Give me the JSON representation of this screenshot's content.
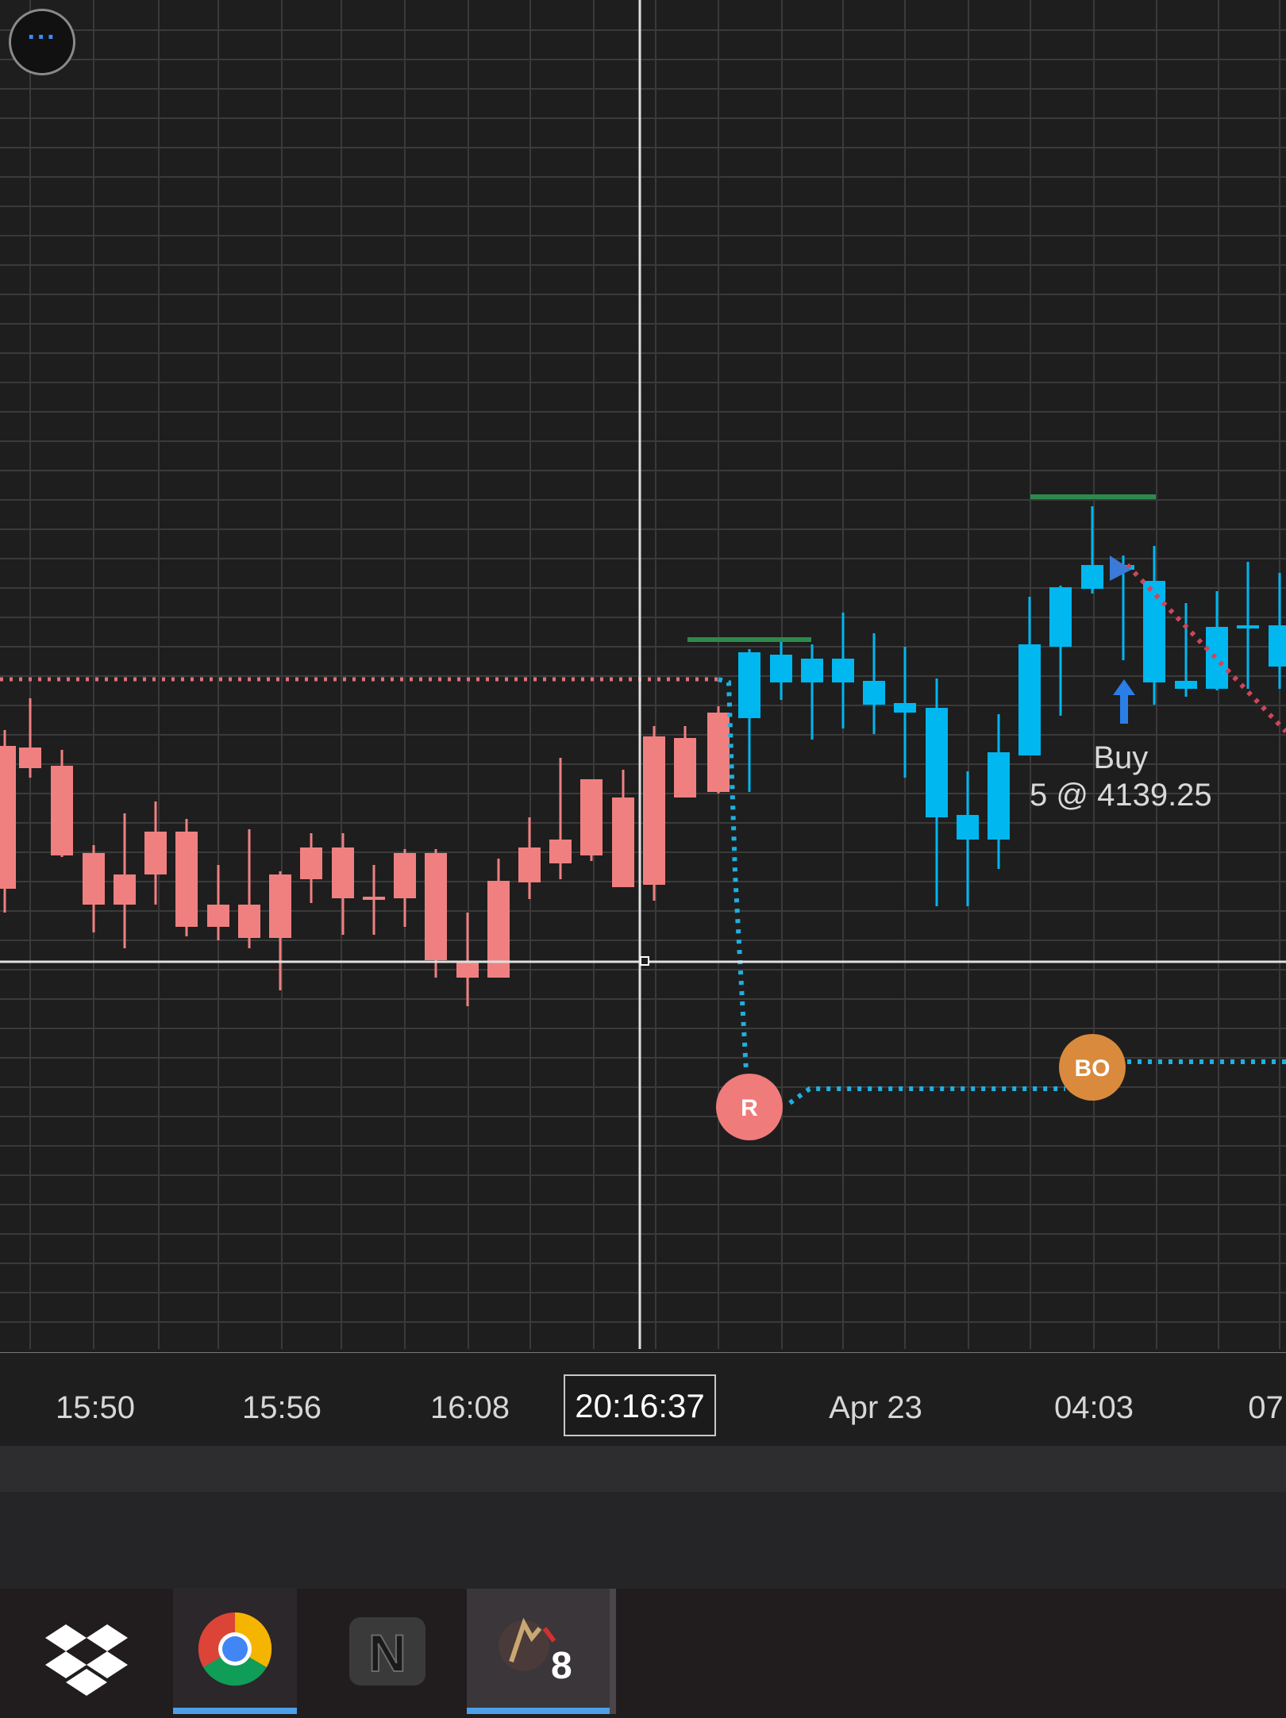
{
  "chart": {
    "x_axis_labels": [
      "15:50",
      "15:56",
      "16:08",
      "Apr 23",
      "04:03",
      "07:"
    ],
    "crosshair_time": "20:16:37",
    "menu_label": "···",
    "order_markers": [
      {
        "id": "R",
        "label": "R",
        "color": "#f07b7b"
      },
      {
        "id": "BO",
        "label": "BO",
        "color": "#d98a3c"
      }
    ],
    "buy_annotation": {
      "title": "Buy",
      "detail": "5 @ 4139.25"
    },
    "colors": {
      "up_candle": "#00b7f0",
      "down_candle": "#f08080",
      "background": "#1e1e1e",
      "grid": "#3a3a3a",
      "high_marker": "#2d8a4e",
      "order_line": "#1eb0e0",
      "stop_line": "#e0707a",
      "buy_arrow": "#2a7ee8",
      "crosshair": "#e0e0e0"
    }
  },
  "taskbar": {
    "icons": [
      {
        "name": "dropbox-icon",
        "active": false
      },
      {
        "name": "chrome-icon",
        "active": true
      },
      {
        "name": "ninjatrader-icon",
        "active": false
      },
      {
        "name": "trading-app-icon",
        "badge": "8",
        "active": true
      }
    ]
  }
}
